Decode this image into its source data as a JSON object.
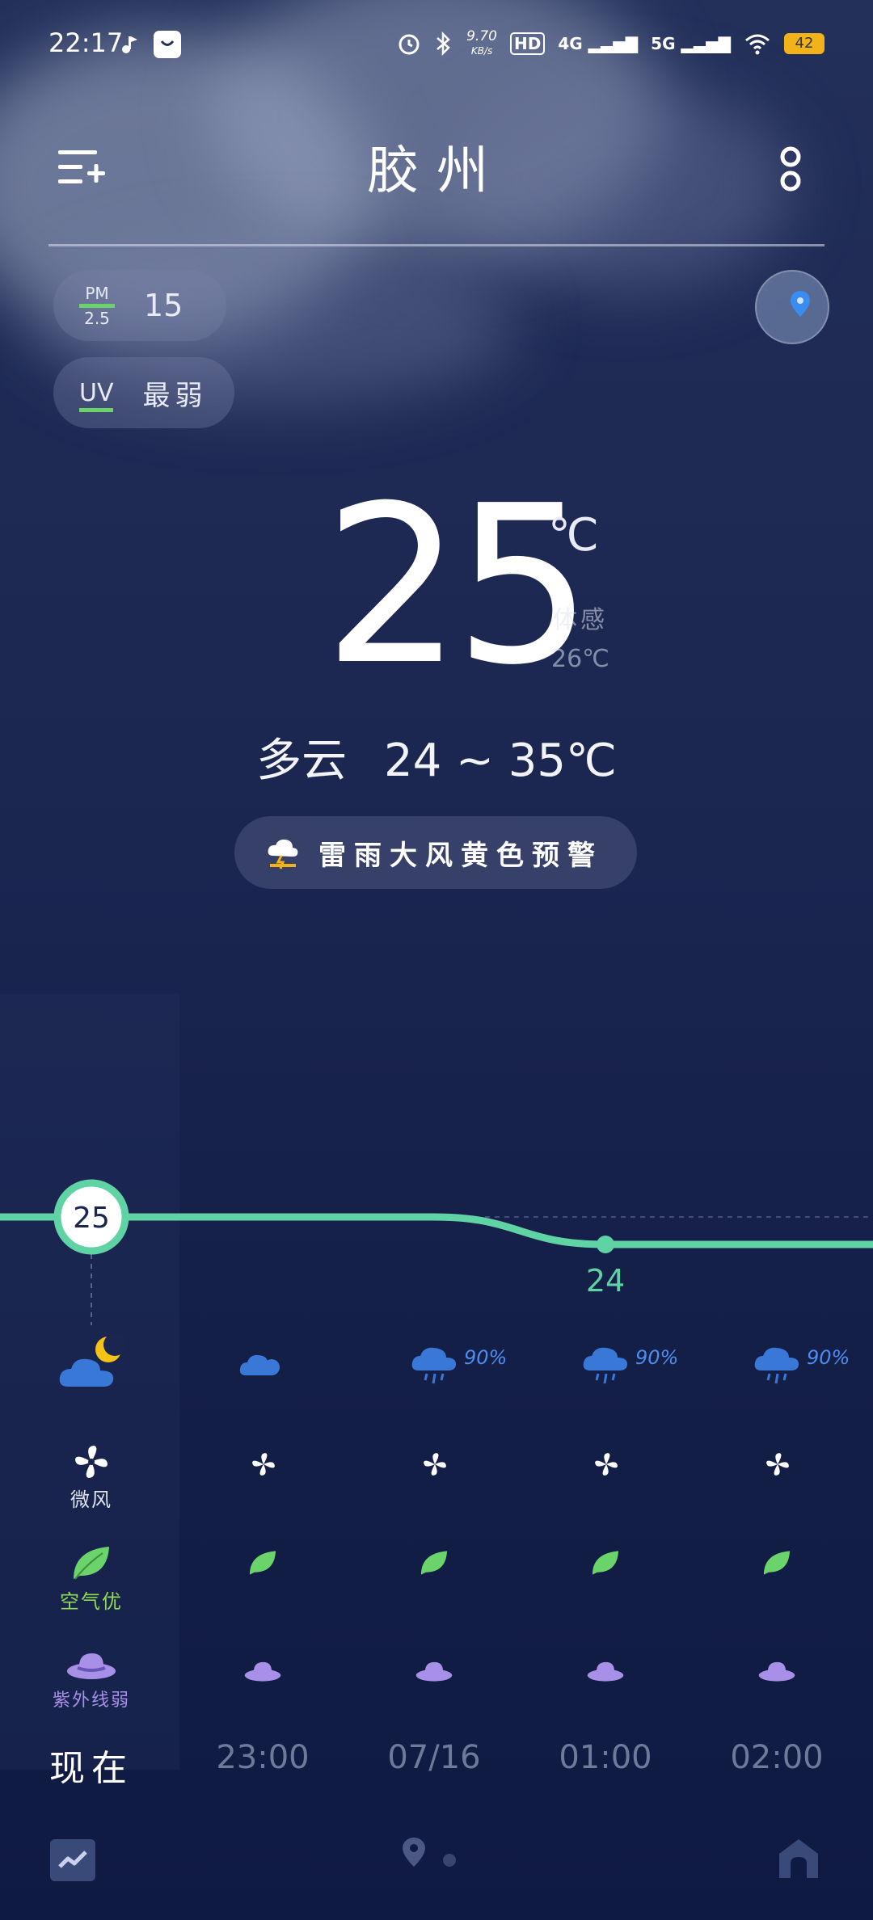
{
  "status_bar": {
    "time": "22:17",
    "net_speed": "9.70",
    "net_unit": "KB/s",
    "hd": "HD",
    "net4g": "4G",
    "net5g": "5G",
    "battery": "42"
  },
  "header": {
    "city": "胶州"
  },
  "pm25": {
    "label_top": "PM",
    "label_bottom": "2.5",
    "value": "15"
  },
  "uv": {
    "label": "UV",
    "value": "最弱"
  },
  "current": {
    "temp": "25",
    "unit": "℃",
    "feels_label": "体感",
    "feels_value": "26℃",
    "condition": "多云",
    "range": "24 ~ 35℃"
  },
  "alert": {
    "label": "雷雨大风黄色预警"
  },
  "chart_data": {
    "type": "line",
    "x": [
      "现在",
      "23:00",
      "07/16",
      "01:00",
      "02:00"
    ],
    "series": [
      {
        "values": [
          25,
          25,
          25,
          24,
          24
        ]
      }
    ],
    "labels": [
      {
        "x": "现在",
        "y": 25,
        "text": "25"
      },
      {
        "x": "01:00",
        "y": 24,
        "text": "24"
      }
    ]
  },
  "hourly": [
    {
      "time": "现在",
      "icon": "cloudy-night-icon",
      "rain": "",
      "wind": "微风",
      "air": "空气优",
      "uv": "紫外线弱"
    },
    {
      "time": "23:00",
      "icon": "cloudy-icon",
      "rain": "",
      "wind": "",
      "air": "",
      "uv": ""
    },
    {
      "time": "07/16",
      "icon": "rain-icon",
      "rain": "90%",
      "wind": "",
      "air": "",
      "uv": ""
    },
    {
      "time": "01:00",
      "icon": "rain-icon",
      "rain": "90%",
      "wind": "",
      "air": "",
      "uv": ""
    },
    {
      "time": "02:00",
      "icon": "rain-icon",
      "rain": "90%",
      "wind": "",
      "air": "",
      "uv": ""
    }
  ],
  "colors": {
    "line": "#5fd3a4",
    "rain": "#4e8df0",
    "leaf": "#6ad46a",
    "uv": "#a88fe8"
  }
}
